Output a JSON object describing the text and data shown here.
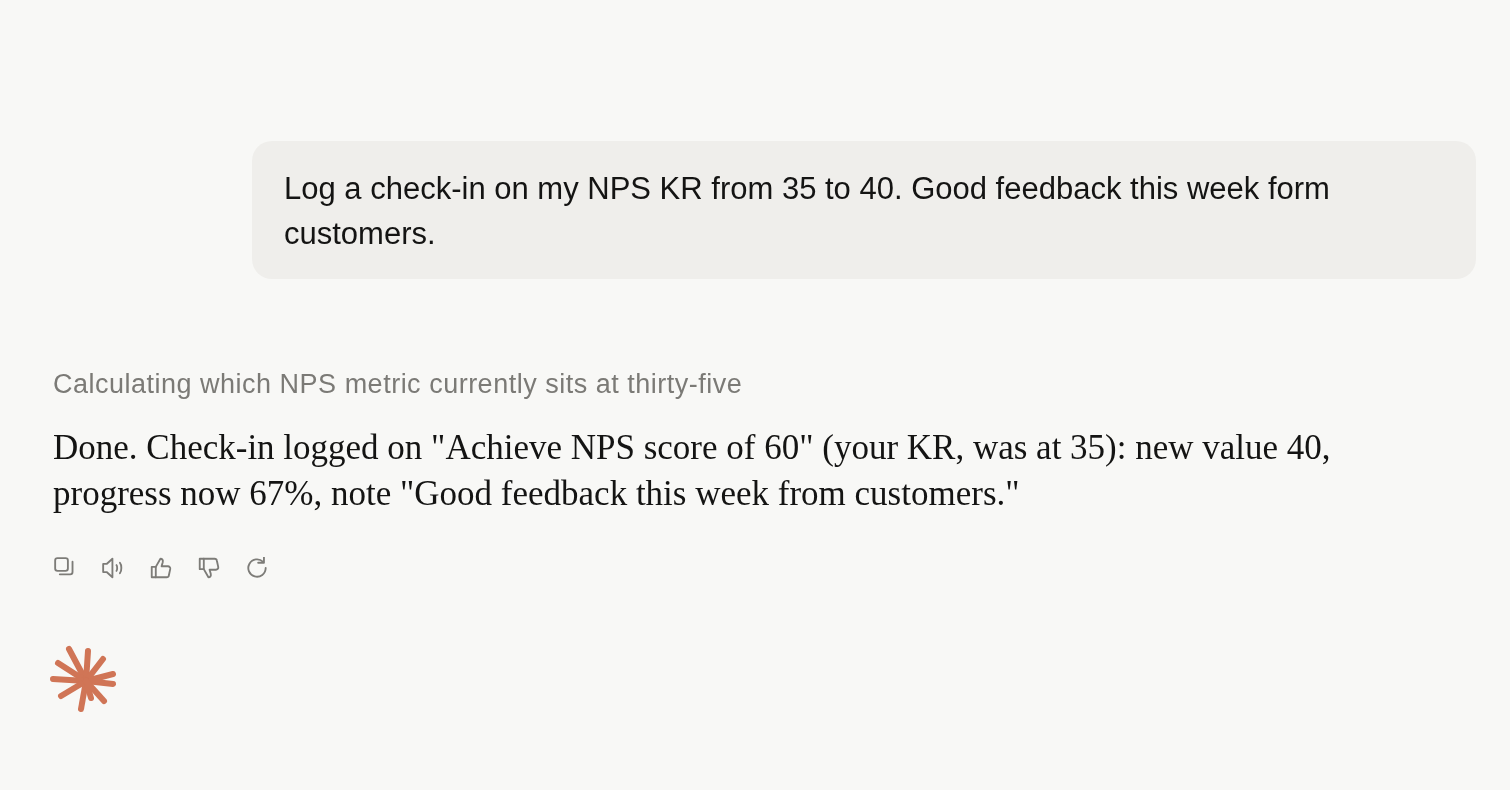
{
  "user_message": {
    "text": "Log a check-in on my NPS KR from 35 to 40. Good feedback this week form customers."
  },
  "assistant": {
    "status": "Calculating which NPS metric currently sits at thirty-five",
    "reply": "Done. Check-in logged on \"Achieve NPS score of 60\" (your KR, was at 35): new value 40, progress now 67%, note \"Good feedback this week from customers.\"",
    "actions": [
      {
        "kind": "copy"
      },
      {
        "kind": "speak"
      },
      {
        "kind": "thumbs-up"
      },
      {
        "kind": "thumbs-down"
      },
      {
        "kind": "retry"
      }
    ]
  }
}
